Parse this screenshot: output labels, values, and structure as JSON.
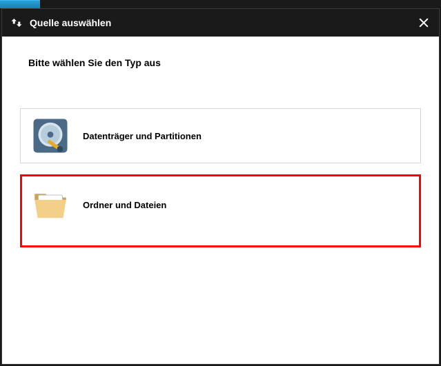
{
  "titlebar": {
    "icon": "swap-icon",
    "title": "Quelle auswählen",
    "close_label": "Close"
  },
  "content": {
    "prompt": "Bitte wählen Sie den Typ aus",
    "options": {
      "disk": {
        "label": "Datenträger und Partitionen",
        "icon": "disk-icon"
      },
      "folder": {
        "label": "Ordner und Dateien",
        "icon": "folder-icon"
      }
    }
  }
}
